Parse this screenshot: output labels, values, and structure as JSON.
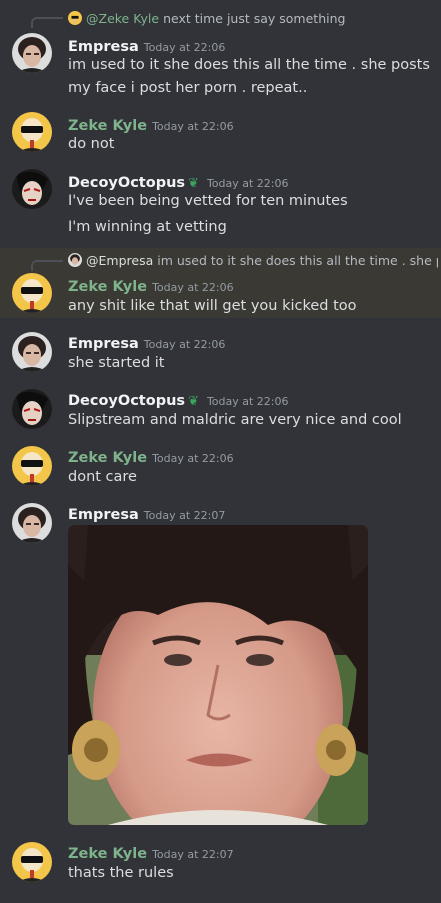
{
  "colors": {
    "zeke": "#7fb38c",
    "white": "#f2f3f5",
    "bg": "#313338",
    "highlight": "#3a3933"
  },
  "messages": [
    {
      "reply": {
        "name": "@Zeke Kyle",
        "text": "next time just say something"
      },
      "author": "Empresa",
      "time": "Today at 22:06",
      "lines": [
        "im  used to it she does this all the time . she posts",
        "my face i post her porn . repeat.."
      ]
    },
    {
      "author": "Zeke Kyle",
      "time": "Today at 22:06",
      "lines": [
        "do not"
      ]
    },
    {
      "author": "DecoyOctopus",
      "time": "Today at 22:06",
      "lines": [
        "I've been being vetted for ten minutes",
        "I'm winning at vetting"
      ]
    },
    {
      "reply": {
        "name": "@Empresa",
        "text": "im used to it she does this all the time . she posts my face i post her porn . repeat.."
      },
      "author": "Zeke Kyle",
      "time": "Today at 22:06",
      "lines": [
        "any shit like that will get you kicked too"
      ]
    },
    {
      "author": "Empresa",
      "time": "Today at 22:06",
      "lines": [
        "she started it"
      ]
    },
    {
      "author": "DecoyOctopus",
      "time": "Today at 22:06",
      "lines": [
        "Slipstream and maldric are very nice and cool"
      ]
    },
    {
      "author": "Zeke Kyle",
      "time": "Today at 22:06",
      "lines": [
        "dont care"
      ]
    },
    {
      "author": "Empresa",
      "time": "Today at 22:07",
      "lines": []
    },
    {
      "author": "Zeke Kyle",
      "time": "Today at 22:07",
      "lines": [
        "thats the rules"
      ]
    }
  ]
}
